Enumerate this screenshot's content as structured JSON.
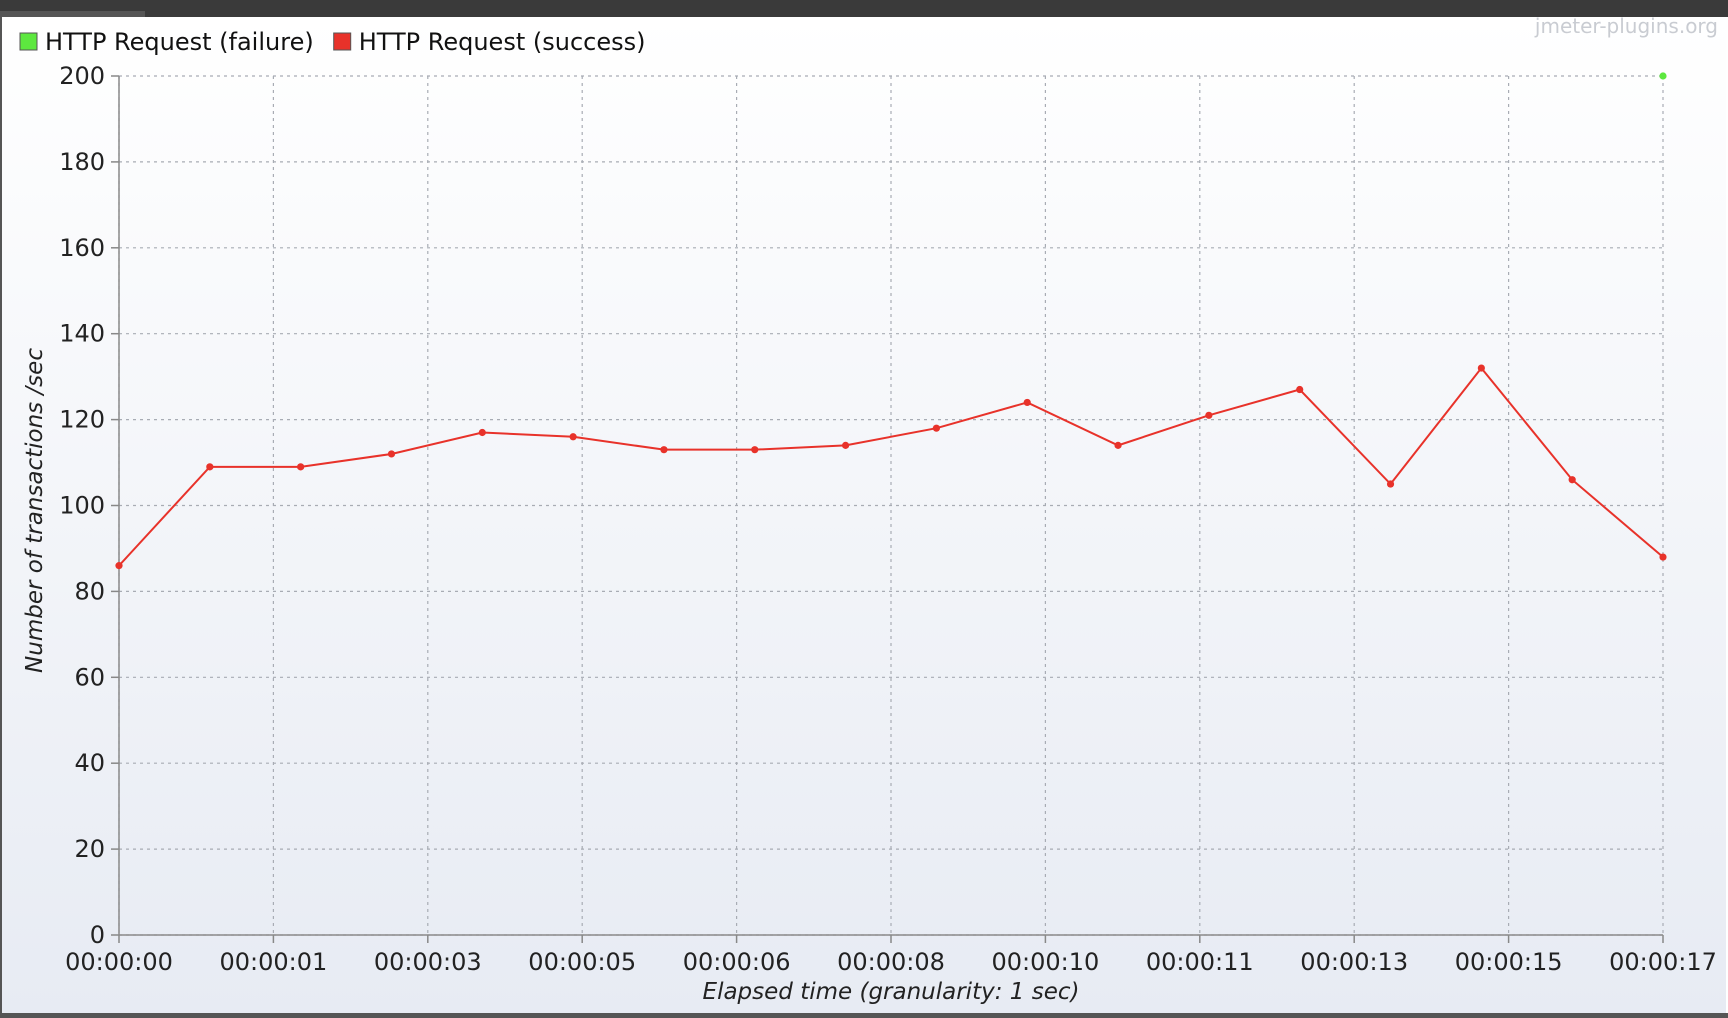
{
  "watermark": "jmeter-plugins.org",
  "chart_data": {
    "type": "line",
    "xlabel": "Elapsed time (granularity: 1 sec)",
    "ylabel": "Number of transactions /sec",
    "ylim": [
      0,
      200
    ],
    "yticks": [
      0,
      20,
      40,
      60,
      80,
      100,
      120,
      140,
      160,
      180,
      200
    ],
    "xlim": [
      0,
      17
    ],
    "xticks": [
      {
        "t": 0,
        "label": "00:00:00"
      },
      {
        "t": 1.7,
        "label": "00:00:01"
      },
      {
        "t": 3.4,
        "label": "00:00:03"
      },
      {
        "t": 5.1,
        "label": "00:00:05"
      },
      {
        "t": 6.8,
        "label": "00:00:06"
      },
      {
        "t": 8.5,
        "label": "00:00:08"
      },
      {
        "t": 10.2,
        "label": "00:00:10"
      },
      {
        "t": 11.9,
        "label": "00:00:11"
      },
      {
        "t": 13.6,
        "label": "00:00:13"
      },
      {
        "t": 15.3,
        "label": "00:00:15"
      },
      {
        "t": 17,
        "label": "00:00:17"
      }
    ],
    "grid": true,
    "legend_position": "top-left",
    "series": [
      {
        "name": "HTTP Request (failure)",
        "color": "#5de83f",
        "x": [
          17
        ],
        "y": [
          200
        ]
      },
      {
        "name": "HTTP Request (success)",
        "color": "#e8322a",
        "x": [
          0,
          1,
          2,
          3,
          4,
          5,
          6,
          7,
          8,
          9,
          10,
          11,
          12,
          13,
          14,
          15,
          16,
          17
        ],
        "y": [
          86,
          109,
          109,
          112,
          117,
          116,
          113,
          113,
          114,
          118,
          124,
          114,
          121,
          127,
          105,
          132,
          106,
          88
        ]
      }
    ]
  }
}
